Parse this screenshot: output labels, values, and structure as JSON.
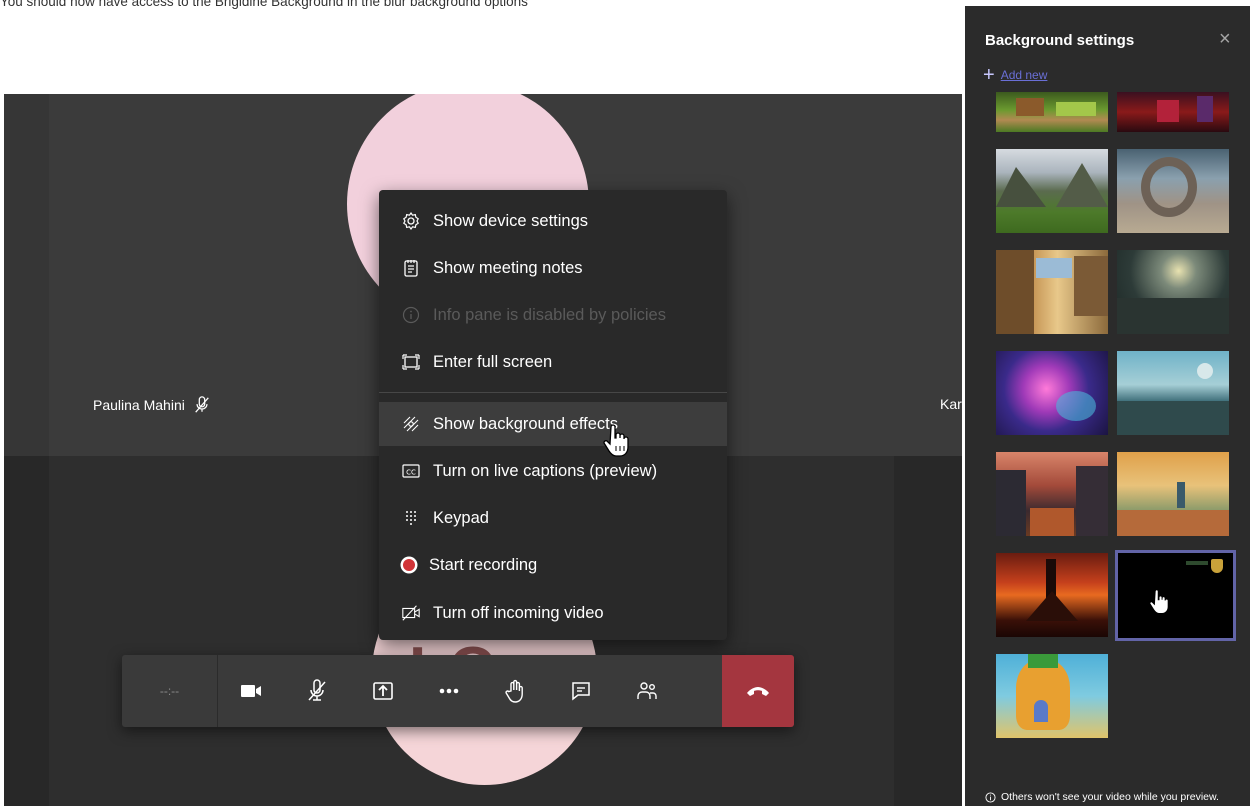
{
  "instruction_text": "You should now have access to the Brigidine Background in the blur background options",
  "participants": {
    "left_name": "Paulina Mahini",
    "right_name_partial": "Kar",
    "initials": "LQ"
  },
  "menu": {
    "items": [
      {
        "label": "Show device settings",
        "icon": "gear-icon",
        "disabled": false
      },
      {
        "label": "Show meeting notes",
        "icon": "notes-icon",
        "disabled": false
      },
      {
        "label": "Info pane is disabled by policies",
        "icon": "info-icon",
        "disabled": true
      },
      {
        "label": "Enter full screen",
        "icon": "fullscreen-icon",
        "disabled": false
      },
      {
        "label": "Show background effects",
        "icon": "background-effects-icon",
        "disabled": false,
        "hovered": true
      },
      {
        "label": "Turn on live captions (preview)",
        "icon": "captions-icon",
        "disabled": false
      },
      {
        "label": "Keypad",
        "icon": "keypad-icon",
        "disabled": false
      },
      {
        "label": "Start recording",
        "icon": "record-icon",
        "disabled": false
      },
      {
        "label": "Turn off incoming video",
        "icon": "video-off-icon",
        "disabled": false
      }
    ]
  },
  "toolbar": {
    "timer": "--:--",
    "buttons": [
      "camera-icon",
      "mic-muted-icon",
      "share-icon",
      "more-icon",
      "raise-hand-icon",
      "chat-icon",
      "participants-icon",
      "hangup-icon"
    ]
  },
  "background_panel": {
    "title": "Background settings",
    "close_glyph": "×",
    "add_new": "Add new",
    "footer": "Others won't see your video while you preview.",
    "thumbnails": [
      {
        "name": "minecraft-garden"
      },
      {
        "name": "minecraft-nether"
      },
      {
        "name": "green-valley"
      },
      {
        "name": "stone-ring"
      },
      {
        "name": "fantasy-street"
      },
      {
        "name": "alien-planet"
      },
      {
        "name": "nebula"
      },
      {
        "name": "ocean-sunset"
      },
      {
        "name": "village-street"
      },
      {
        "name": "autumn-landscape"
      },
      {
        "name": "volcano-tower"
      },
      {
        "name": "brigidine-black",
        "selected": true
      },
      {
        "name": "pineapple-house"
      }
    ]
  },
  "colors": {
    "accent": "#6264a7",
    "hangup": "#a4363f",
    "menu_bg": "#292929",
    "panel_bg": "#2b2b2b"
  }
}
